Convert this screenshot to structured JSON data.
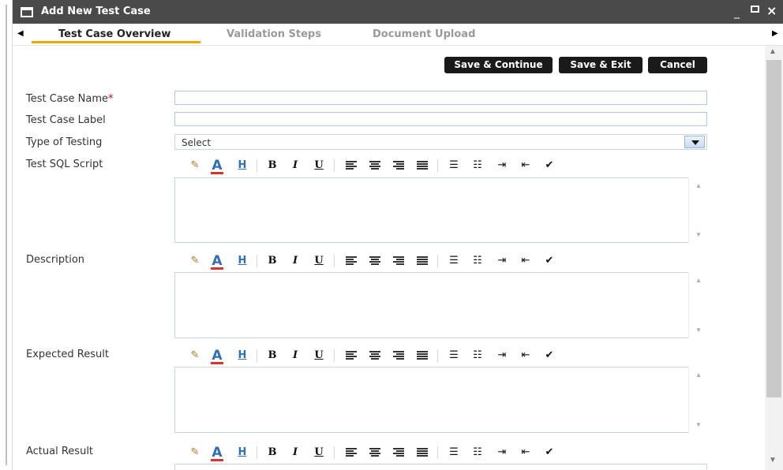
{
  "window": {
    "title": "Add New Test Case",
    "minimize": "_",
    "close": "×"
  },
  "tabs": [
    {
      "label": "Test Case Overview",
      "active": true
    },
    {
      "label": "Validation Steps",
      "active": false
    },
    {
      "label": "Document Upload",
      "active": false
    }
  ],
  "actions": {
    "save_continue": "Save & Continue",
    "save_exit": "Save & Exit",
    "cancel": "Cancel"
  },
  "form": {
    "test_case_name": {
      "label": "Test Case Name",
      "required_mark": "*",
      "value": ""
    },
    "test_case_label": {
      "label": "Test Case Label",
      "value": ""
    },
    "type_of_testing": {
      "label": "Type of Testing",
      "value": "Select"
    },
    "test_sql_script": {
      "label": "Test SQL Script",
      "value": ""
    },
    "description": {
      "label": "Description",
      "value": ""
    },
    "expected_result": {
      "label": "Expected Result",
      "value": ""
    },
    "actual_result": {
      "label": "Actual Result",
      "value": ""
    }
  },
  "toolbar": {
    "bold": "B",
    "italic": "I",
    "underline": "U",
    "font_color": "A",
    "highlight": "H"
  },
  "colors": {
    "titlebar": "#4a4a4a",
    "tab_underline": "#f0a800",
    "button": "#1a1a1a",
    "required": "#d0021b"
  }
}
